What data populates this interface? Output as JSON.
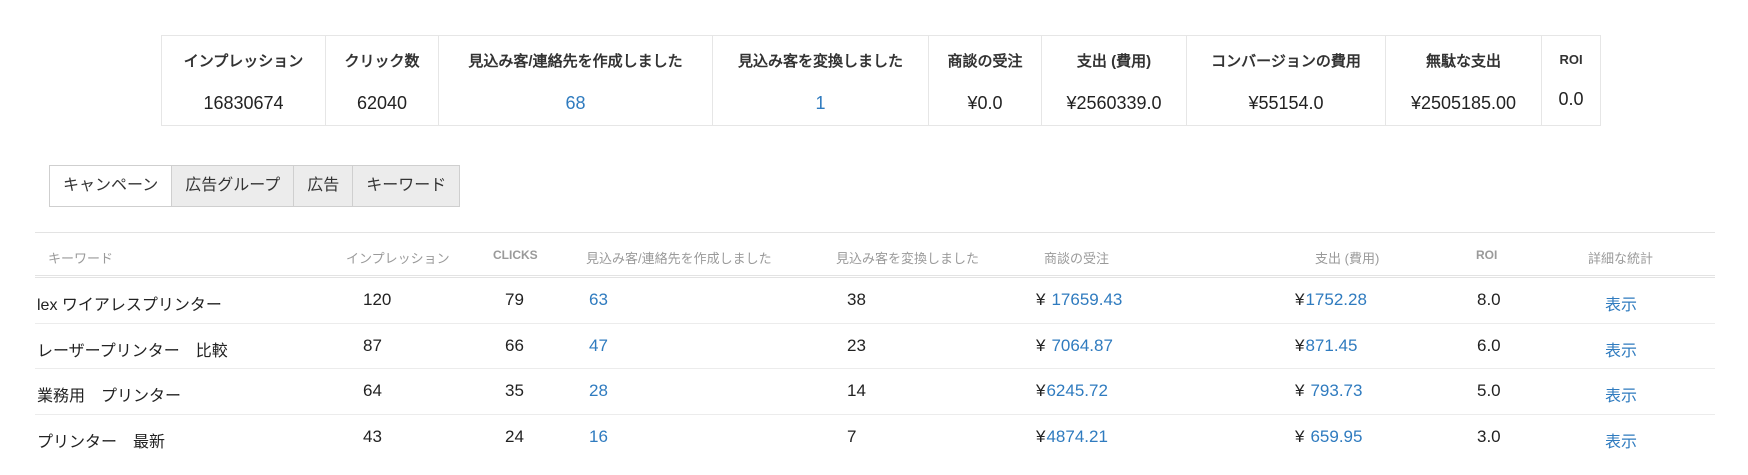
{
  "summary": {
    "headers": [
      "インプレッション",
      "クリック数",
      "見込み客/連絡先を作成しました",
      "見込み客を変換しました",
      "商談の受注",
      "支出 (費用)",
      "コンバージョンの費用",
      "無駄な支出",
      "ROI"
    ],
    "values": [
      "16830674",
      "62040",
      "68",
      "1",
      "¥0.0",
      "¥2560339.0",
      "¥55154.0",
      "¥2505185.00",
      "0.0"
    ]
  },
  "tabs": [
    "キャンペーン",
    "広告グループ",
    "広告",
    "キーワード"
  ],
  "table": {
    "headers": [
      "キーワード",
      "インプレッション",
      "CLICKS",
      "見込み客/連絡先を作成しました",
      "見込み客を変換しました",
      "商談の受注",
      "支出 (費用)",
      "ROI",
      "詳細な統計"
    ],
    "currency_symbol": "¥",
    "rows": [
      {
        "keyword": "lex ワイアレスプリンター",
        "impressions": "120",
        "clicks": "79",
        "leads": "63",
        "converted": "38",
        "won": "17659.43",
        "spend": "1752.28",
        "roi": "8.0",
        "view": "表示"
      },
      {
        "keyword": "レーザープリンター　比較",
        "impressions": "87",
        "clicks": "66",
        "leads": "47",
        "converted": "23",
        "won": "7064.87",
        "spend": "871.45",
        "roi": "6.0",
        "view": "表示"
      },
      {
        "keyword": "業務用　プリンター",
        "impressions": "64",
        "clicks": "35",
        "leads": "28",
        "converted": "14",
        "won": "6245.72",
        "spend": "793.73",
        "roi": "5.0",
        "view": "表示"
      },
      {
        "keyword": "プリンター　最新",
        "impressions": "43",
        "clicks": "24",
        "leads": "16",
        "converted": "7",
        "won": "4874.21",
        "spend": "659.95",
        "roi": "3.0",
        "view": "表示"
      }
    ]
  },
  "colors": {
    "link": "#2f7bbf",
    "tab_inactive": "#ececec",
    "border": "#e6e6e6"
  }
}
